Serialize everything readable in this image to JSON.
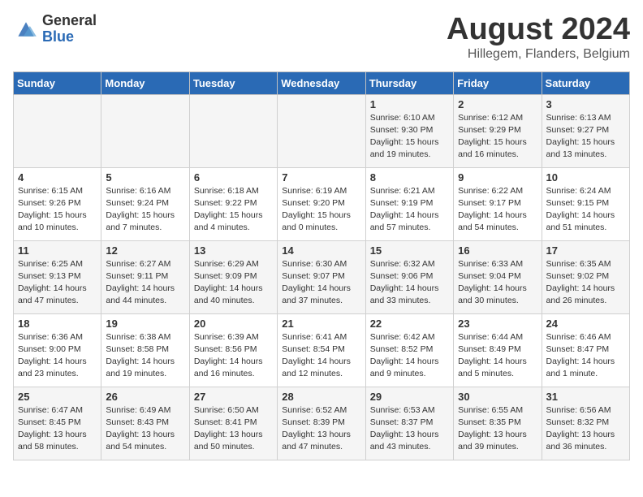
{
  "logo": {
    "general": "General",
    "blue": "Blue"
  },
  "header": {
    "title": "August 2024",
    "subtitle": "Hillegem, Flanders, Belgium"
  },
  "days_of_week": [
    "Sunday",
    "Monday",
    "Tuesday",
    "Wednesday",
    "Thursday",
    "Friday",
    "Saturday"
  ],
  "weeks": [
    [
      {
        "num": "",
        "info": ""
      },
      {
        "num": "",
        "info": ""
      },
      {
        "num": "",
        "info": ""
      },
      {
        "num": "",
        "info": ""
      },
      {
        "num": "1",
        "info": "Sunrise: 6:10 AM\nSunset: 9:30 PM\nDaylight: 15 hours\nand 19 minutes."
      },
      {
        "num": "2",
        "info": "Sunrise: 6:12 AM\nSunset: 9:29 PM\nDaylight: 15 hours\nand 16 minutes."
      },
      {
        "num": "3",
        "info": "Sunrise: 6:13 AM\nSunset: 9:27 PM\nDaylight: 15 hours\nand 13 minutes."
      }
    ],
    [
      {
        "num": "4",
        "info": "Sunrise: 6:15 AM\nSunset: 9:26 PM\nDaylight: 15 hours\nand 10 minutes."
      },
      {
        "num": "5",
        "info": "Sunrise: 6:16 AM\nSunset: 9:24 PM\nDaylight: 15 hours\nand 7 minutes."
      },
      {
        "num": "6",
        "info": "Sunrise: 6:18 AM\nSunset: 9:22 PM\nDaylight: 15 hours\nand 4 minutes."
      },
      {
        "num": "7",
        "info": "Sunrise: 6:19 AM\nSunset: 9:20 PM\nDaylight: 15 hours\nand 0 minutes."
      },
      {
        "num": "8",
        "info": "Sunrise: 6:21 AM\nSunset: 9:19 PM\nDaylight: 14 hours\nand 57 minutes."
      },
      {
        "num": "9",
        "info": "Sunrise: 6:22 AM\nSunset: 9:17 PM\nDaylight: 14 hours\nand 54 minutes."
      },
      {
        "num": "10",
        "info": "Sunrise: 6:24 AM\nSunset: 9:15 PM\nDaylight: 14 hours\nand 51 minutes."
      }
    ],
    [
      {
        "num": "11",
        "info": "Sunrise: 6:25 AM\nSunset: 9:13 PM\nDaylight: 14 hours\nand 47 minutes."
      },
      {
        "num": "12",
        "info": "Sunrise: 6:27 AM\nSunset: 9:11 PM\nDaylight: 14 hours\nand 44 minutes."
      },
      {
        "num": "13",
        "info": "Sunrise: 6:29 AM\nSunset: 9:09 PM\nDaylight: 14 hours\nand 40 minutes."
      },
      {
        "num": "14",
        "info": "Sunrise: 6:30 AM\nSunset: 9:07 PM\nDaylight: 14 hours\nand 37 minutes."
      },
      {
        "num": "15",
        "info": "Sunrise: 6:32 AM\nSunset: 9:06 PM\nDaylight: 14 hours\nand 33 minutes."
      },
      {
        "num": "16",
        "info": "Sunrise: 6:33 AM\nSunset: 9:04 PM\nDaylight: 14 hours\nand 30 minutes."
      },
      {
        "num": "17",
        "info": "Sunrise: 6:35 AM\nSunset: 9:02 PM\nDaylight: 14 hours\nand 26 minutes."
      }
    ],
    [
      {
        "num": "18",
        "info": "Sunrise: 6:36 AM\nSunset: 9:00 PM\nDaylight: 14 hours\nand 23 minutes."
      },
      {
        "num": "19",
        "info": "Sunrise: 6:38 AM\nSunset: 8:58 PM\nDaylight: 14 hours\nand 19 minutes."
      },
      {
        "num": "20",
        "info": "Sunrise: 6:39 AM\nSunset: 8:56 PM\nDaylight: 14 hours\nand 16 minutes."
      },
      {
        "num": "21",
        "info": "Sunrise: 6:41 AM\nSunset: 8:54 PM\nDaylight: 14 hours\nand 12 minutes."
      },
      {
        "num": "22",
        "info": "Sunrise: 6:42 AM\nSunset: 8:52 PM\nDaylight: 14 hours\nand 9 minutes."
      },
      {
        "num": "23",
        "info": "Sunrise: 6:44 AM\nSunset: 8:49 PM\nDaylight: 14 hours\nand 5 minutes."
      },
      {
        "num": "24",
        "info": "Sunrise: 6:46 AM\nSunset: 8:47 PM\nDaylight: 14 hours\nand 1 minute."
      }
    ],
    [
      {
        "num": "25",
        "info": "Sunrise: 6:47 AM\nSunset: 8:45 PM\nDaylight: 13 hours\nand 58 minutes."
      },
      {
        "num": "26",
        "info": "Sunrise: 6:49 AM\nSunset: 8:43 PM\nDaylight: 13 hours\nand 54 minutes."
      },
      {
        "num": "27",
        "info": "Sunrise: 6:50 AM\nSunset: 8:41 PM\nDaylight: 13 hours\nand 50 minutes."
      },
      {
        "num": "28",
        "info": "Sunrise: 6:52 AM\nSunset: 8:39 PM\nDaylight: 13 hours\nand 47 minutes."
      },
      {
        "num": "29",
        "info": "Sunrise: 6:53 AM\nSunset: 8:37 PM\nDaylight: 13 hours\nand 43 minutes."
      },
      {
        "num": "30",
        "info": "Sunrise: 6:55 AM\nSunset: 8:35 PM\nDaylight: 13 hours\nand 39 minutes."
      },
      {
        "num": "31",
        "info": "Sunrise: 6:56 AM\nSunset: 8:32 PM\nDaylight: 13 hours\nand 36 minutes."
      }
    ]
  ]
}
